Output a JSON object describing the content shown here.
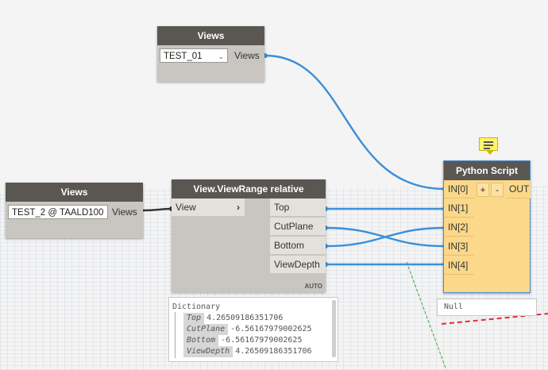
{
  "views_top": {
    "title": "Views",
    "selected": "TEST_01",
    "output": "Views"
  },
  "views_left": {
    "title": "Views",
    "selected": "TEST_2 @ TAALD100",
    "output": "Views"
  },
  "viewrange": {
    "title": "View.ViewRange relative",
    "input": "View",
    "outputs": [
      "Top",
      "CutPlane",
      "Bottom",
      "ViewDepth"
    ],
    "lacing": "AUTO"
  },
  "preview": {
    "title": "Dictionary",
    "rows": [
      {
        "key": "Top",
        "value": "4.26509186351706"
      },
      {
        "key": "CutPlane",
        "value": "-6.56167979002625"
      },
      {
        "key": "Bottom",
        "value": "-6.56167979002625"
      },
      {
        "key": "ViewDepth",
        "value": "4.26509186351706"
      }
    ]
  },
  "python": {
    "title": "Python Script",
    "inputs": [
      "IN[0]",
      "IN[1]",
      "IN[2]",
      "IN[3]",
      "IN[4]"
    ],
    "add": "+",
    "remove": "-",
    "output": "OUT",
    "result": "Null"
  },
  "colors": {
    "wire": "#3a8fd8",
    "header": "#5a5752",
    "python_body": "#fbd88a",
    "grid": "#9fb3c8"
  }
}
